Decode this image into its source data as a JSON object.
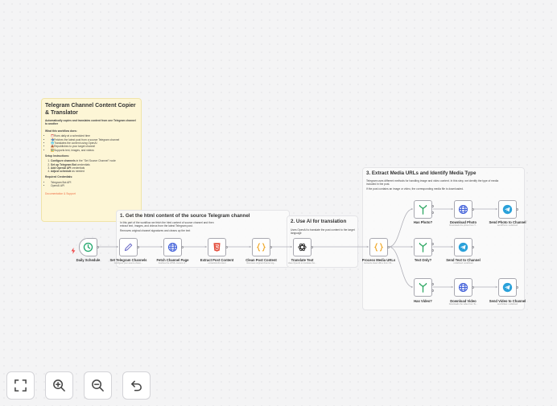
{
  "notes": {
    "main": {
      "title": "Telegram Channel Content Copier & Translator",
      "subtitle": "Automatically copies and translates content from one Telegram channel to another",
      "does_heading": "What this workflow does:",
      "does": [
        "⏰Runs daily at a scheduled time",
        "📬Fetches the latest post from a source Telegram channel",
        "🌐Translates the content using OpenAI",
        "📤Republishes to your target channel",
        "🖼️Supports text, images, and videos"
      ],
      "setup_heading": "Setup Instructions:",
      "setup": [
        {
          "bold": "Configure channels",
          "rest": " in the \"Set Source Channel\" node"
        },
        {
          "bold": "Set up Telegram Bot",
          "rest": " credentials"
        },
        {
          "bold": "Add OpenAI API",
          "rest": " credentials"
        },
        {
          "bold": "Adjust schedule",
          "rest": " as needed"
        }
      ],
      "creds_heading": "Required Credentials:",
      "creds": [
        "Telegram Bot API",
        "OpenAI API"
      ],
      "link": "Documentation & Support"
    },
    "section1": {
      "title": "1. Get the html content of the source Telegram channel",
      "body": [
        "In this part of the workflow we fetch the html content of source channel and then extract text, images, and videos from the latest Telegram post.",
        "Removes original channel signatures and cleans up the text"
      ]
    },
    "section2": {
      "title": "2. Use AI for translation",
      "body": [
        "Uses OpenAI to translate the post content to the target language"
      ]
    },
    "section3": {
      "title": "3. Extract Media URLs and Identify Media Type",
      "body": [
        "Telegram uses different methods for handling image and video content. In this step, we identify the type of media included in the post.",
        "If the post contains an image or video, the corresponding media file is downloaded."
      ]
    }
  },
  "nodes": {
    "daily_schedule": {
      "label": "Daily Schedule",
      "sub": ""
    },
    "set_channels": {
      "label": "Set Telegram Channels",
      "sub": "Configure your source chann..."
    },
    "fetch_page": {
      "label": "Fetch Channel Page",
      "sub": "Fetches the HTML content of..."
    },
    "extract_post": {
      "label": "Extract Post Content",
      "sub": "extractHtmlContent"
    },
    "clean_post": {
      "label": "Clean Post Content",
      "sub": "Removes original channel sig..."
    },
    "translate": {
      "label": "Translate Text",
      "sub": "Uses OpenAI to translate the..."
    },
    "process_media": {
      "label": "Process Media URLs",
      "sub": "Extracts clean URLs from CS..."
    },
    "has_photo": {
      "label": "Has Photo?",
      "sub": ""
    },
    "text_only": {
      "label": "Text Only?",
      "sub": ""
    },
    "has_video": {
      "label": "Has Video?",
      "sub": ""
    },
    "download_photo": {
      "label": "Download Photo",
      "sub": "Downloads the photo from T..."
    },
    "download_video": {
      "label": "Download Video",
      "sub": "Downloads the video from Te..."
    },
    "send_photo": {
      "label": "Send Photo to Channel",
      "sub": "sendPhoto: undefined"
    },
    "send_text": {
      "label": "Send Text to Channel",
      "sub": "undefined: undefined"
    },
    "send_video": {
      "label": "Send Video to Channel",
      "sub": "sendVideo: undefined"
    }
  },
  "colors": {
    "schedule": "#1fa66b",
    "set": "#6b6bc8",
    "http": "#3b5bd8",
    "html": "#e4503f",
    "code": "#f0a622",
    "if": "#22a35a",
    "telegram": "#2aa1da",
    "trigger_bolt": "#ef4444",
    "link": "#ef6f45"
  },
  "controls": {
    "fit_view": "fit-view-icon",
    "zoom_in": "zoom-in-icon",
    "zoom_out": "zoom-out-icon",
    "reset": "undo-icon"
  }
}
